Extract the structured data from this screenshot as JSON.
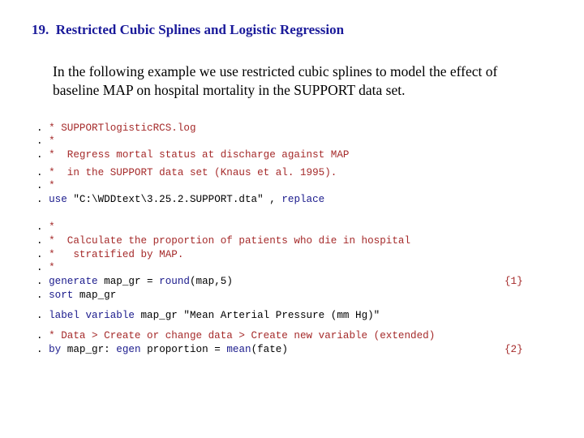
{
  "title": "19.  Restricted Cubic Splines and Logistic Regression",
  "intro": {
    "line1": "In the following example we use restricted cubic splines to model the effect of",
    "line2": "baseline MAP on hospital mortality in the SUPPORT data set."
  },
  "colors": {
    "title": "#1a1a9a",
    "comment": "#a52a2a",
    "keyword": "#1a1a8c",
    "text": "#000000"
  },
  "code": {
    "prompt": ".",
    "l1": {
      "comment": "* SUPPORTlogisticRCS.log"
    },
    "l2": {
      "comment": "*"
    },
    "l3": {
      "comment": "*  Regress mortal status at discharge against MAP"
    },
    "l4": {
      "comment": "*  in the SUPPORT data set (Knaus et al. 1995)."
    },
    "l5": {
      "comment": "*"
    },
    "l6": {
      "kw1": "use",
      "text1": " \"C:\\WDDtext\\3.25.2.SUPPORT.dta\" , ",
      "kw2": "replace"
    },
    "l7": {
      "comment": "*"
    },
    "l8": {
      "comment": "*  Calculate the proportion of patients who die in hospital"
    },
    "l9": {
      "comment": "*   stratified by MAP."
    },
    "l10": {
      "comment": "*"
    },
    "l11": {
      "kw1": "generate",
      "text1": " map_gr = ",
      "kw2": "round",
      "text2": "(map,5)",
      "note": "{1}"
    },
    "l12": {
      "kw1": "sort",
      "text1": " map_gr"
    },
    "l13": {
      "kw1": "label variable",
      "text1": " map_gr \"Mean Arterial Pressure (mm Hg)\""
    },
    "l14": {
      "comment": "* Data > Create or change data > Create new variable (extended)"
    },
    "l15": {
      "kw1": "by",
      "text1": " map_gr: ",
      "kw2": "egen",
      "text2": " proportion = ",
      "kw3": "mean",
      "text3": "(fate)",
      "note": "{2}"
    }
  }
}
